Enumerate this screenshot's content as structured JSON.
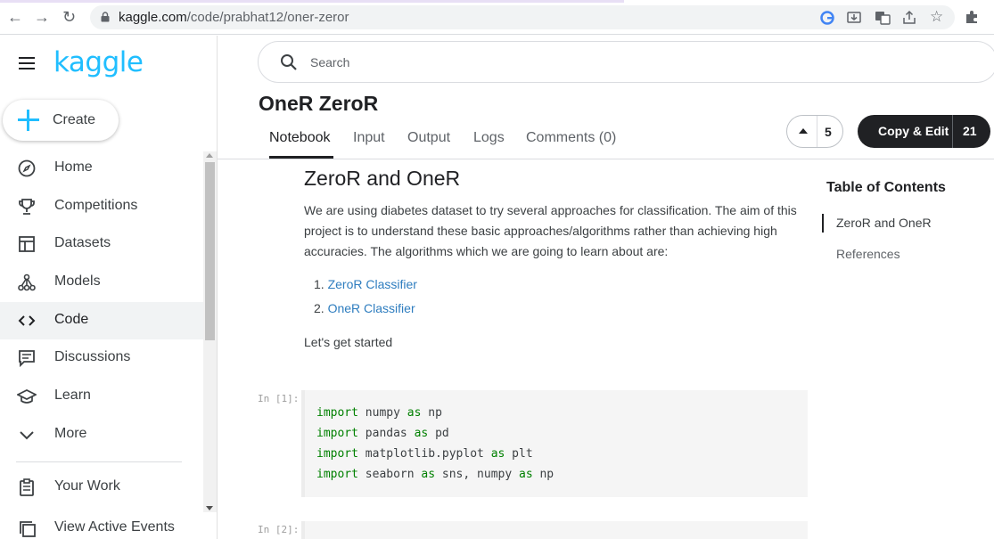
{
  "browser": {
    "url_host": "kaggle.com",
    "url_path": "/code/prabhat12/oner-zeror"
  },
  "sidebar": {
    "logo": "kaggle",
    "create_label": "Create",
    "items": [
      {
        "label": "Home",
        "icon": "compass-icon"
      },
      {
        "label": "Competitions",
        "icon": "trophy-icon"
      },
      {
        "label": "Datasets",
        "icon": "table-icon"
      },
      {
        "label": "Models",
        "icon": "models-icon"
      },
      {
        "label": "Code",
        "icon": "code-icon",
        "active": true
      },
      {
        "label": "Discussions",
        "icon": "discussions-icon"
      },
      {
        "label": "Learn",
        "icon": "graduation-cap-icon"
      },
      {
        "label": "More",
        "icon": "chevron-down-icon"
      }
    ],
    "secondary": [
      {
        "label": "Your Work",
        "icon": "clipboard-icon"
      },
      {
        "label": "View Active Events",
        "icon": "events-icon"
      }
    ]
  },
  "search": {
    "placeholder": "Search"
  },
  "notebook": {
    "title": "OneR ZeroR",
    "tabs": [
      "Notebook",
      "Input",
      "Output",
      "Logs",
      "Comments (0)"
    ],
    "upvotes": "5",
    "copy_edit_label": "Copy & Edit",
    "copy_edit_count": "21"
  },
  "content": {
    "heading": "ZeroR and OneR",
    "intro": "We are using diabetes dataset to try several approaches for classification. The aim of this project is to understand these basic approaches/algorithms rather than achieving high accuracies. The algorithms which we are going to learn about are:",
    "list": [
      {
        "num": "1.",
        "text": "ZeroR Classifier"
      },
      {
        "num": "2.",
        "text": "OneR Classifier"
      }
    ],
    "outro": "Let's get started",
    "cell1_prompt": "In [1]:",
    "cell1_lines": [
      {
        "kw1": "import",
        "mod": " numpy ",
        "kw2": "as",
        "alias": " np"
      },
      {
        "kw1": "import",
        "mod": " pandas ",
        "kw2": "as",
        "alias": " pd"
      },
      {
        "kw1": "import",
        "mod": " matplotlib.pyplot ",
        "kw2": "as",
        "alias": " plt"
      },
      {
        "kw1": "import",
        "mod": " seaborn ",
        "kw2": "as",
        "alias": " sns, numpy ",
        "kw3": "as",
        "alias2": " np"
      }
    ],
    "cell2_prompt": "In [2]:"
  },
  "toc": {
    "title": "Table of Contents",
    "items": [
      "ZeroR and OneR",
      "References"
    ]
  },
  "colors": {
    "kaggle_blue": "#20beff",
    "keyword_green": "#008000",
    "dark_button": "#202124"
  }
}
